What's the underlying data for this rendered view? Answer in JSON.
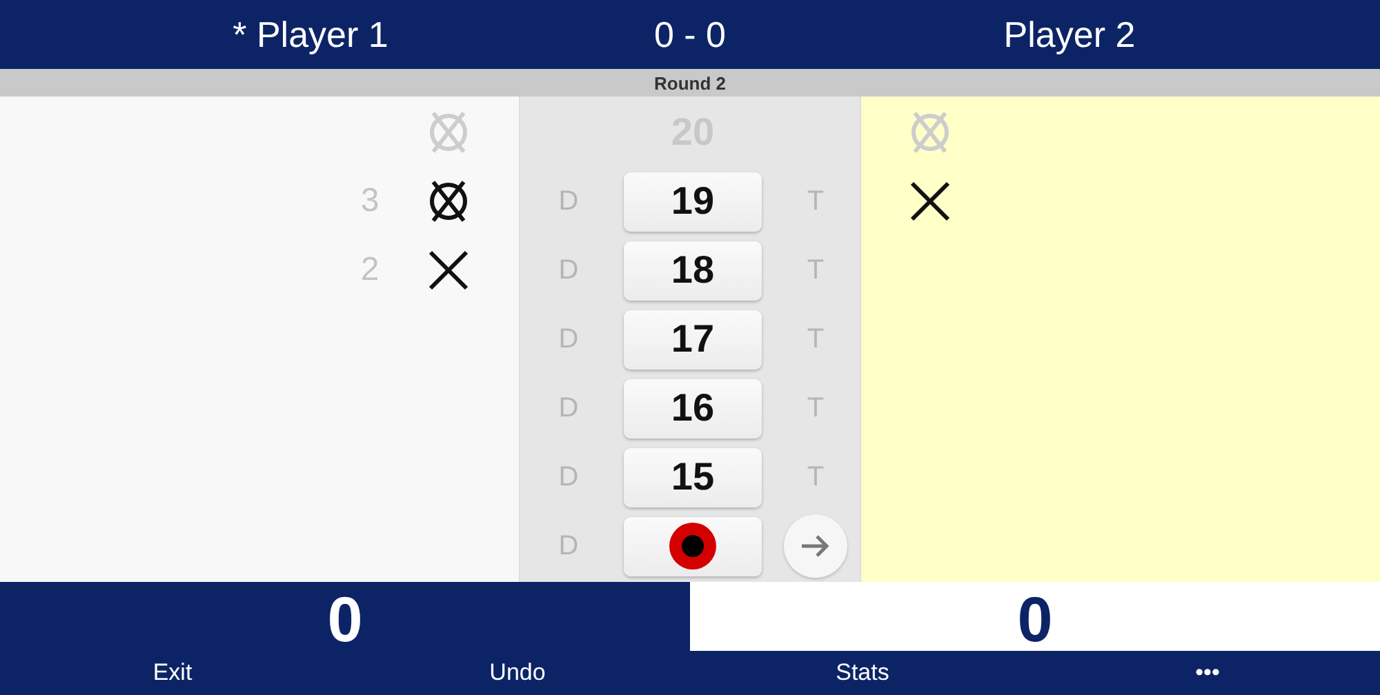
{
  "header": {
    "player_1": "* Player 1",
    "score": "0 - 0",
    "player_2": "Player 2"
  },
  "round": "Round 2",
  "rows": [
    {
      "kind": "number",
      "number": "20",
      "closed": true,
      "p1": {
        "crossed": true,
        "circled": true
      },
      "p2": {
        "crossed": true,
        "circled": true
      }
    },
    {
      "kind": "number",
      "number": "19",
      "closed": false,
      "double_label": "D",
      "triple_label": "T",
      "p1": {
        "count": "3",
        "crossed": true,
        "circled": true
      },
      "p2": {
        "crossed": true,
        "circled": false
      }
    },
    {
      "kind": "number",
      "number": "18",
      "closed": false,
      "double_label": "D",
      "triple_label": "T",
      "p1": {
        "count": "2",
        "crossed": true,
        "circled": false
      },
      "p2": {
        "crossed": false,
        "circled": false
      }
    },
    {
      "kind": "number",
      "number": "17",
      "closed": false,
      "double_label": "D",
      "triple_label": "T",
      "p1": {
        "crossed": false,
        "circled": false
      },
      "p2": {
        "crossed": false,
        "circled": false
      }
    },
    {
      "kind": "number",
      "number": "16",
      "closed": false,
      "double_label": "D",
      "triple_label": "T",
      "p1": {
        "crossed": false,
        "circled": false
      },
      "p2": {
        "crossed": false,
        "circled": false
      }
    },
    {
      "kind": "number",
      "number": "15",
      "closed": false,
      "double_label": "D",
      "triple_label": "T",
      "p1": {
        "crossed": false,
        "circled": false
      },
      "p2": {
        "crossed": false,
        "circled": false
      }
    },
    {
      "kind": "bull",
      "double_label": "D",
      "p1": {
        "crossed": false,
        "circled": false
      },
      "p2": {
        "crossed": false,
        "circled": false
      }
    }
  ],
  "players": [
    {
      "score": "0",
      "active": false
    },
    {
      "score": "0",
      "active": true
    }
  ],
  "footer": [
    "Exit",
    "Undo",
    "Stats",
    "•••"
  ]
}
